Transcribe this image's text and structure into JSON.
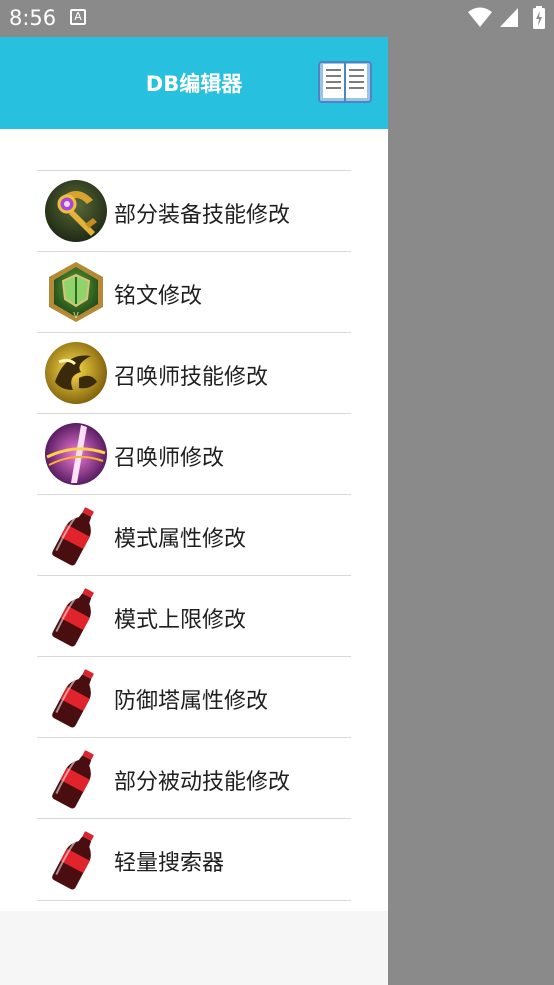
{
  "status_bar": {
    "time": "8:56",
    "notification_glyph": "A"
  },
  "header": {
    "title": "DB编辑器",
    "icon": "book-icon"
  },
  "menu": [
    {
      "label": "部分装备技能修改",
      "icon": "equipment-staff-icon"
    },
    {
      "label": "铭文修改",
      "icon": "inscription-shield-icon"
    },
    {
      "label": "召唤师技能修改",
      "icon": "summoner-skill-icon"
    },
    {
      "label": "召唤师修改",
      "icon": "summoner-purple-icon"
    },
    {
      "label": "模式属性修改",
      "icon": "cola-bottle-icon"
    },
    {
      "label": "模式上限修改",
      "icon": "cola-bottle-icon"
    },
    {
      "label": "防御塔属性修改",
      "icon": "cola-bottle-icon"
    },
    {
      "label": "部分被动技能修改",
      "icon": "cola-bottle-icon"
    },
    {
      "label": "轻量搜索器",
      "icon": "cola-bottle-icon"
    }
  ],
  "colors": {
    "header": "#27c1df",
    "scrim": "#8a8a8a"
  }
}
